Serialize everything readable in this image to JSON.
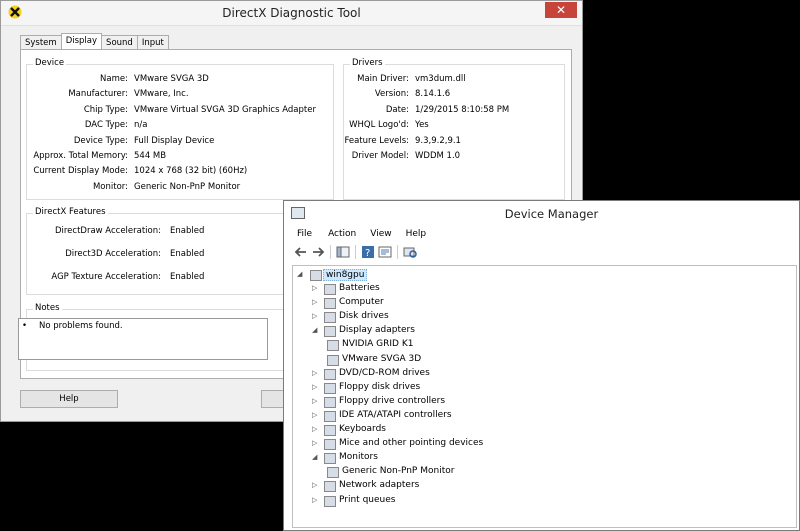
{
  "dxdiag": {
    "title": "DirectX Diagnostic Tool",
    "close_glyph": "✕",
    "tabs": [
      "System",
      "Display",
      "Sound",
      "Input"
    ],
    "device": {
      "title": "Device",
      "rows": [
        {
          "k": "Name:",
          "v": "VMware SVGA 3D"
        },
        {
          "k": "Manufacturer:",
          "v": "VMware, Inc."
        },
        {
          "k": "Chip Type:",
          "v": "VMware Virtual SVGA 3D Graphics Adapter"
        },
        {
          "k": "DAC Type:",
          "v": "n/a"
        },
        {
          "k": "Device Type:",
          "v": "Full Display Device"
        },
        {
          "k": "Approx. Total Memory:",
          "v": "544 MB"
        },
        {
          "k": "Current Display Mode:",
          "v": "1024 x 768 (32 bit) (60Hz)"
        },
        {
          "k": "Monitor:",
          "v": "Generic Non-PnP Monitor"
        }
      ]
    },
    "drivers": {
      "title": "Drivers",
      "rows": [
        {
          "k": "Main Driver:",
          "v": "vm3dum.dll"
        },
        {
          "k": "Version:",
          "v": "8.14.1.6"
        },
        {
          "k": "Date:",
          "v": "1/29/2015 8:10:58 PM"
        },
        {
          "k": "WHQL Logo'd:",
          "v": "Yes"
        },
        {
          "k": "Feature Levels:",
          "v": "9.3,9.2,9.1"
        },
        {
          "k": "Driver Model:",
          "v": "WDDM 1.0"
        }
      ]
    },
    "features": {
      "title": "DirectX Features",
      "rows": [
        {
          "k": "DirectDraw Acceleration:",
          "v": "Enabled"
        },
        {
          "k": "Direct3D Acceleration:",
          "v": "Enabled"
        },
        {
          "k": "AGP Texture Acceleration:",
          "v": "Enabled"
        }
      ]
    },
    "notes": {
      "title": "Notes",
      "bullet": "•",
      "text": "No problems found."
    },
    "help_button": "Help"
  },
  "devmgr": {
    "title": "Device Manager",
    "menu": [
      "File",
      "Action",
      "View",
      "Help"
    ],
    "tree": {
      "root": "win8gpu",
      "items": [
        {
          "label": "Batteries",
          "level": 1,
          "expanded": false
        },
        {
          "label": "Computer",
          "level": 1,
          "expanded": false
        },
        {
          "label": "Disk drives",
          "level": 1,
          "expanded": false
        },
        {
          "label": "Display adapters",
          "level": 1,
          "expanded": true
        },
        {
          "label": "NVIDIA GRID K1",
          "level": 2
        },
        {
          "label": "VMware SVGA 3D",
          "level": 2
        },
        {
          "label": "DVD/CD-ROM drives",
          "level": 1,
          "expanded": false
        },
        {
          "label": "Floppy disk drives",
          "level": 1,
          "expanded": false
        },
        {
          "label": "Floppy drive controllers",
          "level": 1,
          "expanded": false
        },
        {
          "label": "IDE ATA/ATAPI controllers",
          "level": 1,
          "expanded": false
        },
        {
          "label": "Keyboards",
          "level": 1,
          "expanded": false
        },
        {
          "label": "Mice and other pointing devices",
          "level": 1,
          "expanded": false
        },
        {
          "label": "Monitors",
          "level": 1,
          "expanded": true
        },
        {
          "label": "Generic Non-PnP Monitor",
          "level": 2
        },
        {
          "label": "Network adapters",
          "level": 1,
          "expanded": false
        },
        {
          "label": "Print queues",
          "level": 1,
          "expanded": false
        }
      ]
    }
  },
  "colors": {
    "close_red": "#c7443a",
    "tree_selection": "#cde8ff"
  }
}
